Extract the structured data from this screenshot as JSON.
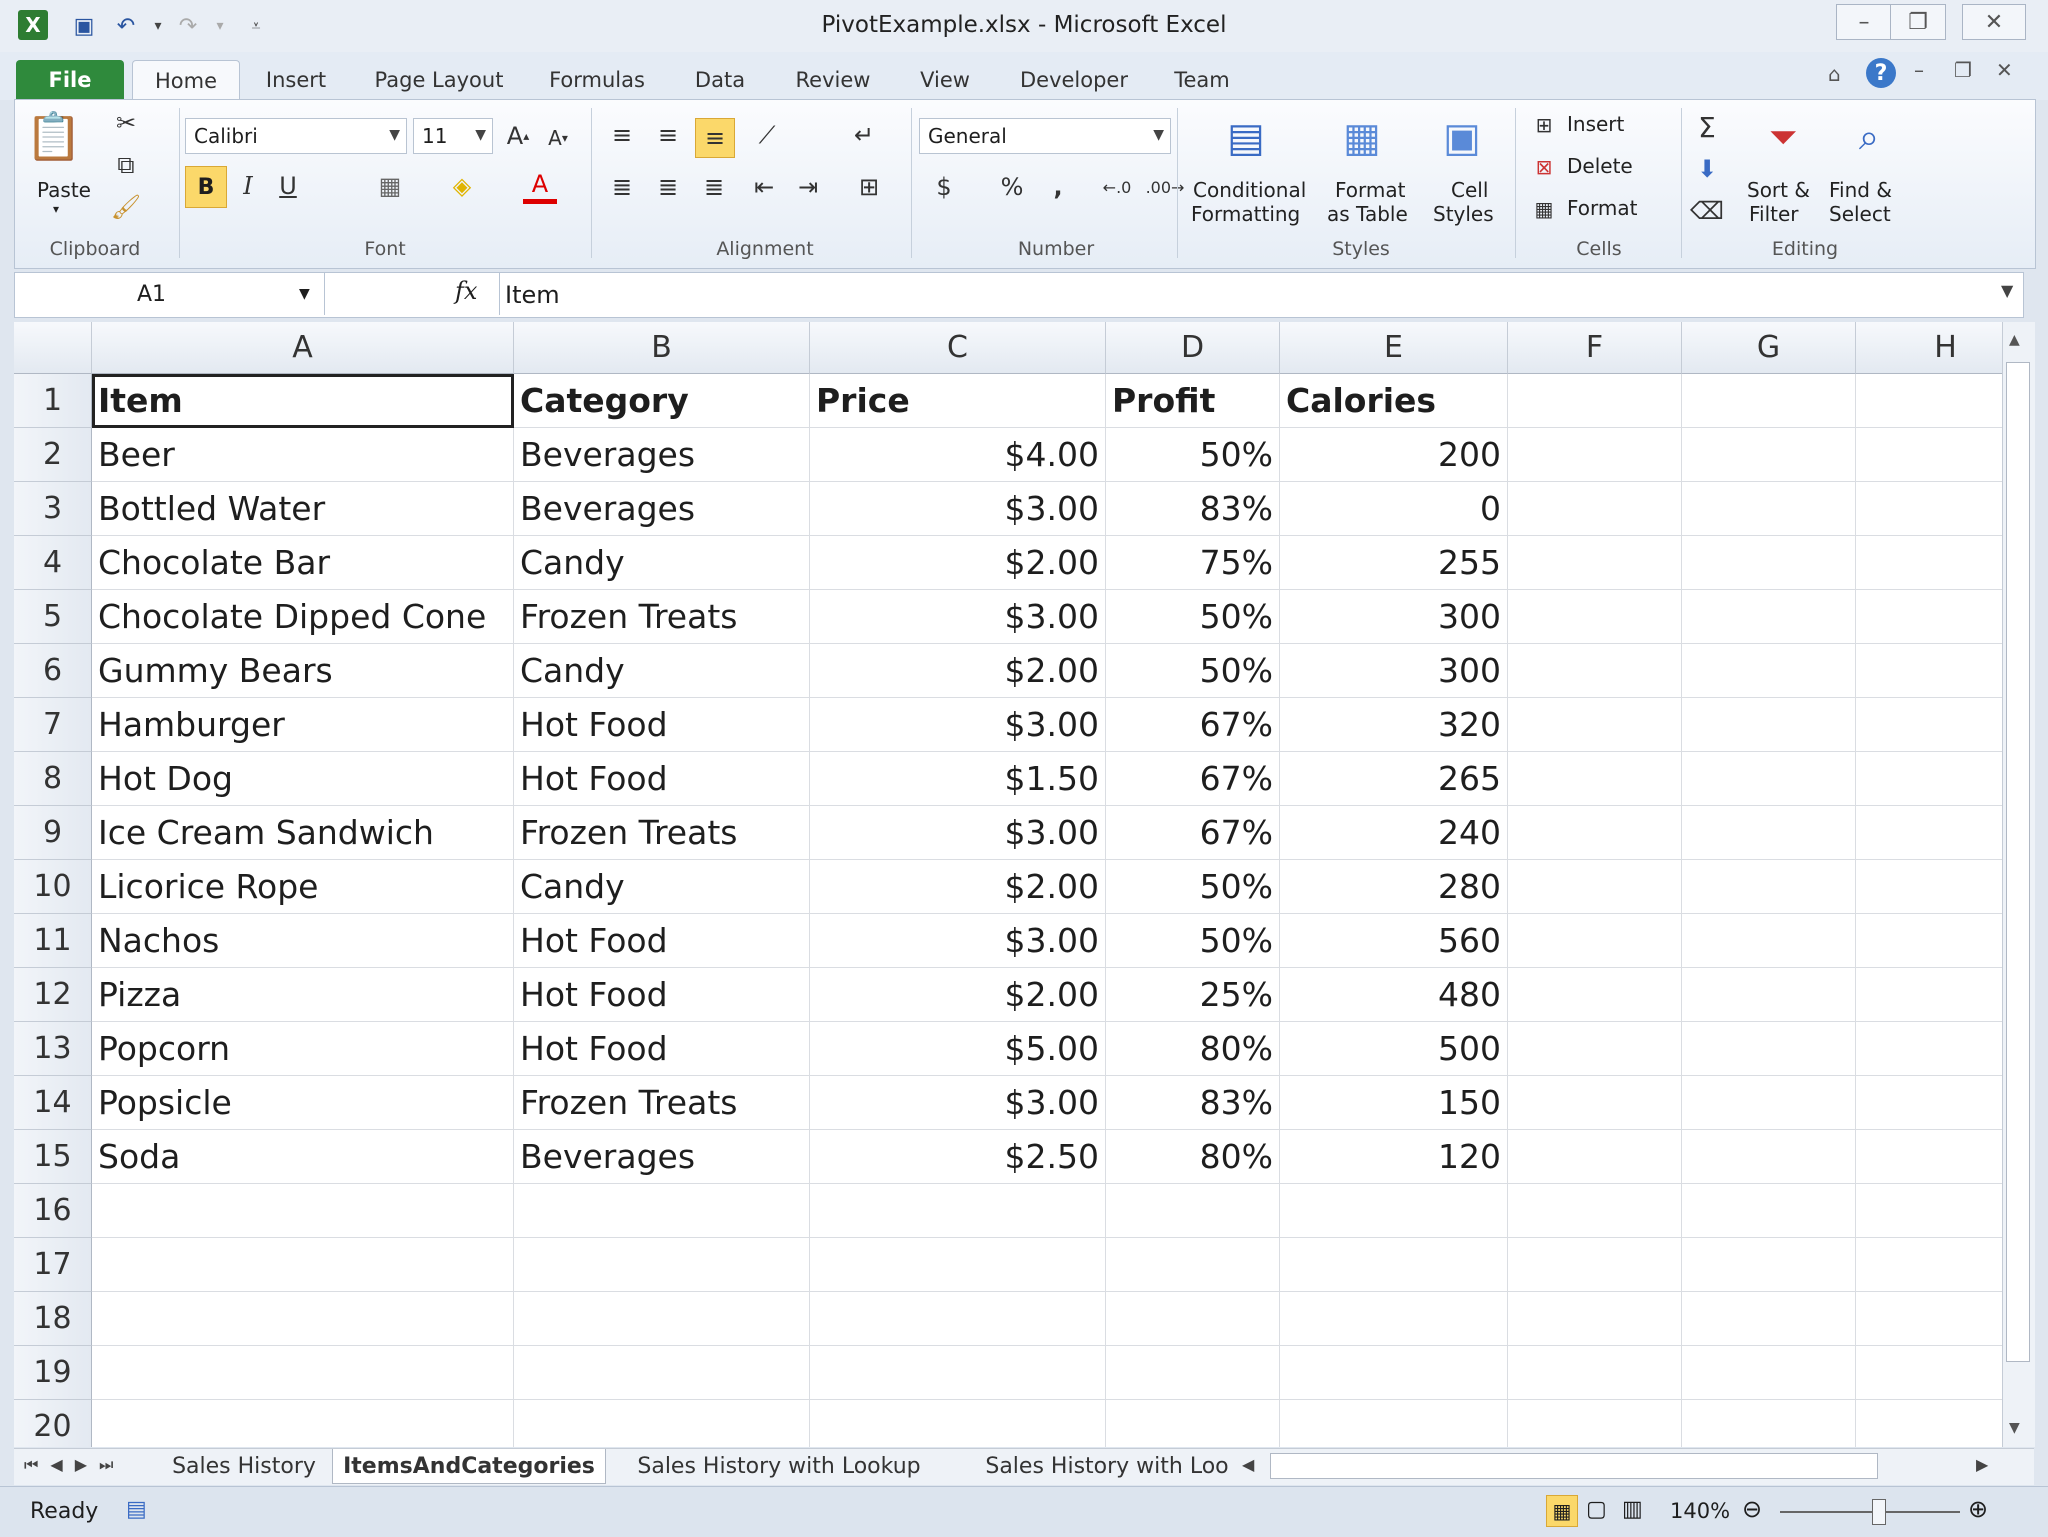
{
  "window": {
    "title": "PivotExample.xlsx - Microsoft Excel"
  },
  "ribbon_tabs": [
    "File",
    "Home",
    "Insert",
    "Page Layout",
    "Formulas",
    "Data",
    "Review",
    "View",
    "Developer",
    "Team"
  ],
  "ribbon": {
    "clipboard": {
      "paste": "Paste",
      "label": "Clipboard"
    },
    "font": {
      "name": "Calibri",
      "size": "11",
      "label": "Font"
    },
    "alignment": {
      "label": "Alignment"
    },
    "number": {
      "format": "General",
      "currency": "$",
      "percent": "%",
      "comma": ",",
      "label": "Number"
    },
    "styles": {
      "conditional_1": "Conditional",
      "conditional_2": "Formatting",
      "format_table_1": "Format",
      "format_table_2": "as Table",
      "cell_styles_1": "Cell",
      "cell_styles_2": "Styles",
      "label": "Styles"
    },
    "cells": {
      "insert": "Insert",
      "delete": "Delete",
      "format": "Format",
      "label": "Cells"
    },
    "editing": {
      "sort_1": "Sort &",
      "sort_2": "Filter",
      "find_1": "Find &",
      "find_2": "Select",
      "label": "Editing"
    }
  },
  "formula_bar": {
    "name_box": "A1",
    "fx": "fx",
    "content": "Item"
  },
  "columns": [
    "A",
    "B",
    "C",
    "D",
    "E",
    "F",
    "G",
    "H"
  ],
  "rows": [
    "1",
    "2",
    "3",
    "4",
    "5",
    "6",
    "7",
    "8",
    "9",
    "10",
    "11",
    "12",
    "13",
    "14",
    "15",
    "16",
    "17",
    "18",
    "19",
    "20"
  ],
  "table": {
    "headers": [
      "Item",
      "Category",
      "Price",
      "Profit",
      "Calories"
    ],
    "data": [
      [
        "Beer",
        "Beverages",
        "$4.00",
        "50%",
        "200"
      ],
      [
        "Bottled Water",
        "Beverages",
        "$3.00",
        "83%",
        "0"
      ],
      [
        "Chocolate Bar",
        "Candy",
        "$2.00",
        "75%",
        "255"
      ],
      [
        "Chocolate Dipped Cone",
        "Frozen Treats",
        "$3.00",
        "50%",
        "300"
      ],
      [
        "Gummy Bears",
        "Candy",
        "$2.00",
        "50%",
        "300"
      ],
      [
        "Hamburger",
        "Hot Food",
        "$3.00",
        "67%",
        "320"
      ],
      [
        "Hot Dog",
        "Hot Food",
        "$1.50",
        "67%",
        "265"
      ],
      [
        "Ice Cream Sandwich",
        "Frozen Treats",
        "$3.00",
        "67%",
        "240"
      ],
      [
        "Licorice Rope",
        "Candy",
        "$2.00",
        "50%",
        "280"
      ],
      [
        "Nachos",
        "Hot Food",
        "$3.00",
        "50%",
        "560"
      ],
      [
        "Pizza",
        "Hot Food",
        "$2.00",
        "25%",
        "480"
      ],
      [
        "Popcorn",
        "Hot Food",
        "$5.00",
        "80%",
        "500"
      ],
      [
        "Popsicle",
        "Frozen Treats",
        "$3.00",
        "83%",
        "150"
      ],
      [
        "Soda",
        "Beverages",
        "$2.50",
        "80%",
        "120"
      ]
    ]
  },
  "sheet_tabs": [
    "Sales History",
    "ItemsAndCategories",
    "Sales History with Lookup",
    "Sales History with Loo"
  ],
  "active_sheet": "ItemsAndCategories",
  "status": {
    "ready": "Ready",
    "zoom": "140%"
  },
  "colors": {
    "file_tab": "#2f8a3c",
    "bold_active": "#fbd86a"
  }
}
